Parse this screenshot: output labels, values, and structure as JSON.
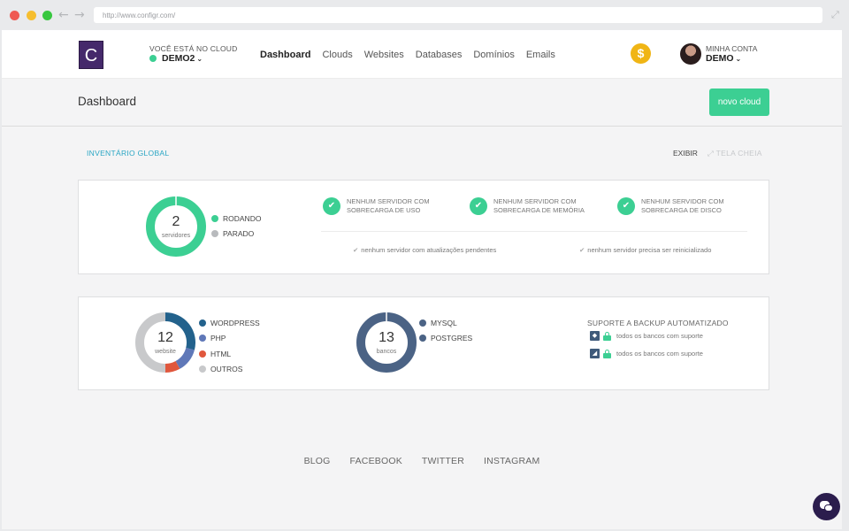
{
  "browser": {
    "url": "http://www.configr.com/"
  },
  "header": {
    "logo_letter": "C",
    "cloud_caption": "VOCÊ ESTÁ NO CLOUD",
    "cloud_name": "DEMO2",
    "nav": [
      "Dashboard",
      "Clouds",
      "Websites",
      "Databases",
      "Domínios",
      "Emails"
    ],
    "active_nav": "Dashboard",
    "credit_symbol": "$",
    "account_caption": "MINHA CONTA",
    "account_name": "DEMO"
  },
  "titlebar": {
    "title": "Dashboard",
    "new_cloud_label": "novo cloud"
  },
  "inventory": {
    "label": "INVENTÁRIO GLOBAL",
    "show_label": "EXIBIR",
    "fullscreen_label": "TELA CHEIA"
  },
  "servers": {
    "count": "2",
    "unit": "servidores",
    "legend": [
      {
        "label": "RODANDO",
        "color": "#3ccf93"
      },
      {
        "label": "PARADO",
        "color": "#b8babd"
      }
    ],
    "checks": [
      "NENHUM SERVIDOR COM SOBRECARGA DE USO",
      "NENHUM SERVIDOR COM SOBRECARGA DE MEMÓRIA",
      "NENHUM SERVIDOR COM SOBRECARGA DE DISCO"
    ],
    "notes": [
      "nenhum servidor com atualizações pendentes",
      "nenhum servidor precisa ser reinicializado"
    ]
  },
  "websites": {
    "count": "12",
    "unit": "website",
    "legend": [
      {
        "label": "WORDPRESS",
        "color": "#23628c"
      },
      {
        "label": "PHP",
        "color": "#5f78b8"
      },
      {
        "label": "HTML",
        "color": "#e0573d"
      },
      {
        "label": "OUTROS",
        "color": "#c8c9cb"
      }
    ]
  },
  "databases": {
    "count": "13",
    "unit": "bancos",
    "legend": [
      {
        "label": "MYSQL",
        "color": "#4b6385"
      },
      {
        "label": "POSTGRES",
        "color": "#4b6385"
      }
    ]
  },
  "backup": {
    "title": "SUPORTE A BACKUP AUTOMATIZADO",
    "rows": [
      {
        "icon": "mysql-icon",
        "text": "todos os bancos com suporte"
      },
      {
        "icon": "postgres-icon",
        "text": "todos os bancos com suporte"
      }
    ]
  },
  "footer": {
    "links": [
      "BLOG",
      "FACEBOOK",
      "TWITTER",
      "INSTAGRAM"
    ]
  }
}
